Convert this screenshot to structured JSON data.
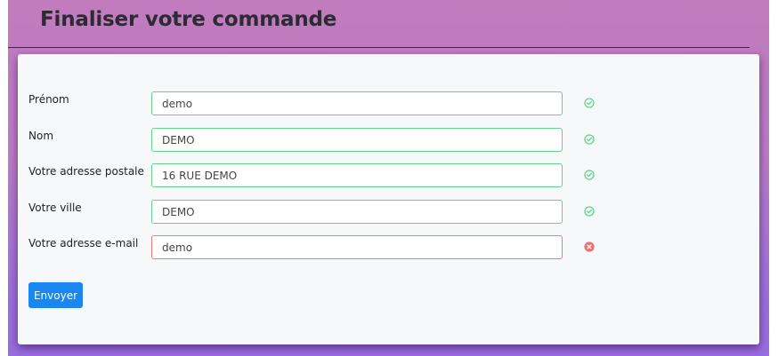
{
  "page": {
    "title": "Finaliser votre commande"
  },
  "form": {
    "fields": [
      {
        "label": "Prénom",
        "value": "demo",
        "status": "valid"
      },
      {
        "label": "Nom",
        "value": "DEMO",
        "status": "valid"
      },
      {
        "label": "Votre adresse postale",
        "value": "16 RUE DEMO",
        "status": "valid"
      },
      {
        "label": "Votre ville",
        "value": "DEMO",
        "status": "valid"
      },
      {
        "label": "Votre adresse e-mail",
        "value": "demo",
        "status": "invalid"
      }
    ],
    "submit_label": "Envoyer"
  },
  "colors": {
    "valid": "#5fd48a",
    "invalid": "#ef7a7a",
    "primary": "#1a87f0"
  },
  "icons": {
    "valid": "check-circle-icon",
    "invalid": "x-circle-icon"
  }
}
